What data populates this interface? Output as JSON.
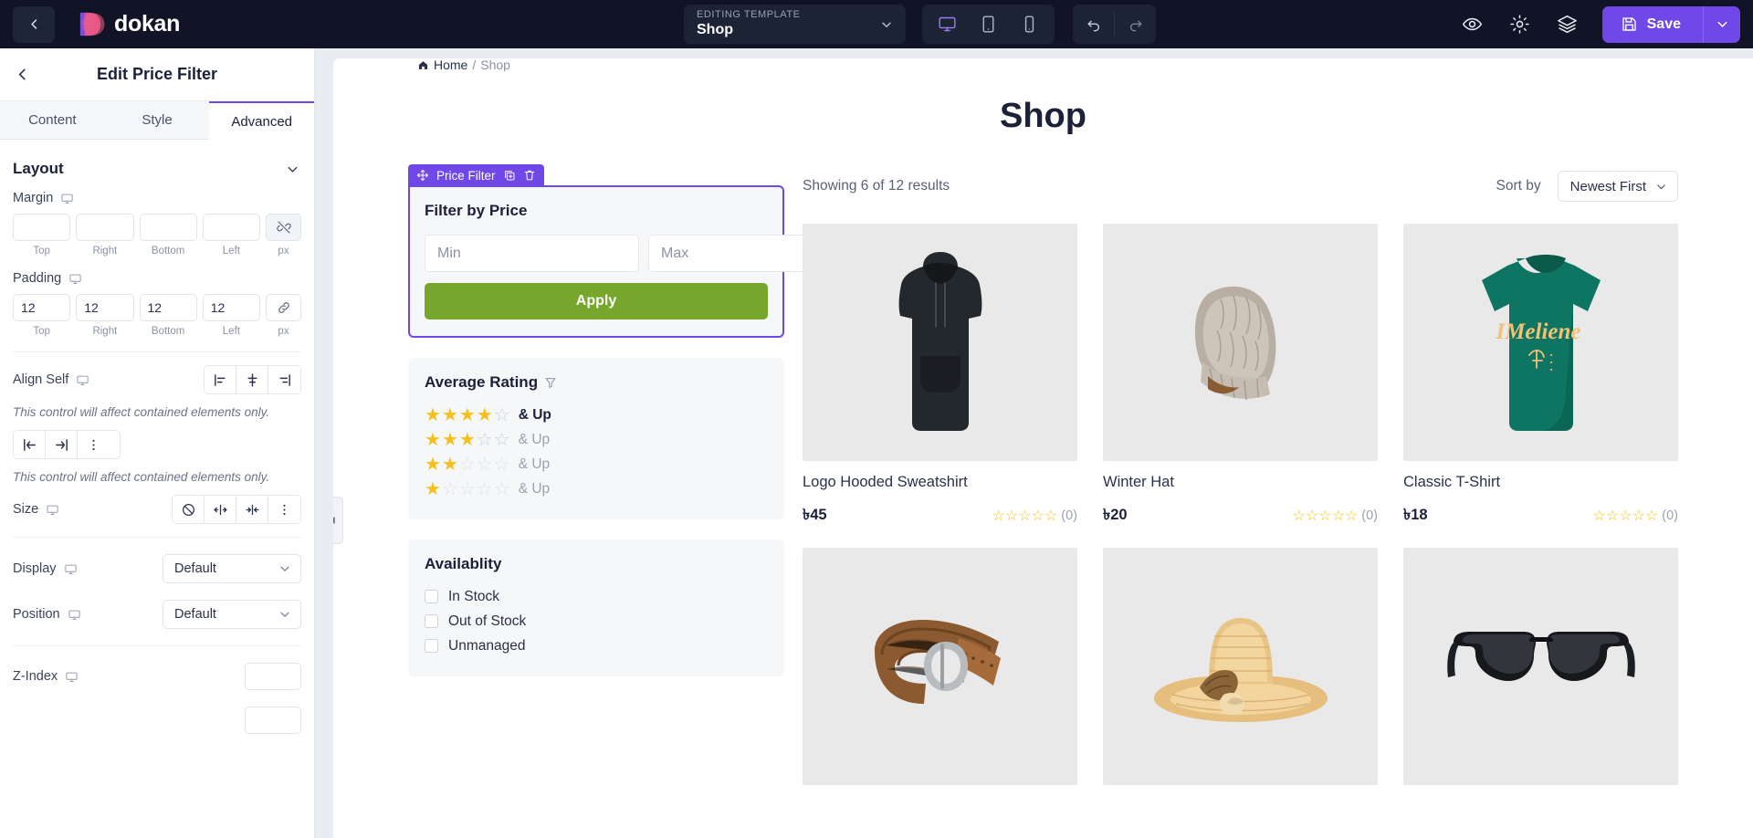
{
  "topbar": {
    "back_icon": "chevron-left-icon",
    "brand": "dokan",
    "template_eyebrow": "EDITING TEMPLATE",
    "template_name": "Shop",
    "devices": [
      {
        "name": "desktop-view-button",
        "icon": "desktop-icon",
        "active": true
      },
      {
        "name": "tablet-view-button",
        "icon": "tablet-icon",
        "active": false
      },
      {
        "name": "mobile-view-button",
        "icon": "mobile-icon",
        "active": false
      }
    ],
    "history": [
      {
        "name": "undo-button",
        "icon": "undo-icon"
      },
      {
        "name": "redo-button",
        "icon": "redo-icon"
      }
    ],
    "right_icons": [
      {
        "name": "preview-button",
        "icon": "eye-icon"
      },
      {
        "name": "settings-button",
        "icon": "gear-icon"
      },
      {
        "name": "layers-button",
        "icon": "layers-icon"
      }
    ],
    "save_label": "Save",
    "save_icon": "floppy-disk-icon",
    "save_caret_icon": "chevron-down-icon",
    "accent": "#7048e8",
    "background": "#101426"
  },
  "sidebar": {
    "back_icon": "chevron-left-icon",
    "title": "Edit Price Filter",
    "tabs": [
      {
        "label": "Content",
        "active": false
      },
      {
        "label": "Style",
        "active": false
      },
      {
        "label": "Advanced",
        "active": true
      }
    ],
    "layout_section": {
      "title": "Layout",
      "collapse_icon": "chevron-down-icon",
      "margin": {
        "label": "Margin",
        "device_icon": "desktop-icon",
        "values": [
          "",
          "",
          "",
          ""
        ],
        "captions": [
          "Top",
          "Right",
          "Bottom",
          "Left"
        ],
        "unit": "px",
        "link_icon": "unlink-icon",
        "linked": false
      },
      "padding": {
        "label": "Padding",
        "device_icon": "desktop-icon",
        "values": [
          "12",
          "12",
          "12",
          "12"
        ],
        "captions": [
          "Top",
          "Right",
          "Bottom",
          "Left"
        ],
        "unit": "px",
        "link_icon": "link-icon",
        "linked": true
      },
      "align_self": {
        "label": "Align Self",
        "device_icon": "desktop-icon",
        "options": [
          "align-start-icon",
          "align-center-icon",
          "align-end-icon"
        ],
        "hint": "This control will affect contained elements only."
      },
      "justify_self": {
        "options": [
          "justify-start-icon",
          "justify-end-icon",
          "more-vertical-icon"
        ],
        "hint": "This control will affect contained elements only."
      },
      "size": {
        "label": "Size",
        "device_icon": "desktop-icon",
        "options": [
          "none-icon",
          "grow-icon",
          "shrink-icon",
          "more-vertical-icon"
        ]
      },
      "display": {
        "label": "Display",
        "device_icon": "desktop-icon",
        "value": "Default",
        "caret_icon": "chevron-down-icon"
      },
      "position": {
        "label": "Position",
        "device_icon": "desktop-icon",
        "value": "Default",
        "caret_icon": "chevron-down-icon"
      },
      "z_index": {
        "label": "Z-Index",
        "device_icon": "desktop-icon",
        "value": ""
      }
    }
  },
  "canvas": {
    "collapse_icon": "chevron-left-icon",
    "breadcrumb": {
      "home": "Home",
      "sep": "/",
      "current": "Shop",
      "home_icon": "home-icon"
    },
    "page_title": "Shop",
    "widget_badge": {
      "label": "Price Filter",
      "drag_icon": "move-icon",
      "duplicate_icon": "duplicate-icon",
      "delete_icon": "trash-icon"
    },
    "price_filter": {
      "title": "Filter by Price",
      "min_placeholder": "Min",
      "min_value": "",
      "max_placeholder": "Max",
      "max_value": "",
      "apply_label": "Apply",
      "apply_color": "#76a62c"
    },
    "average_rating": {
      "title": "Average Rating",
      "filter_icon": "funnel-icon",
      "suffix": "& Up",
      "options": [
        {
          "filled": 4,
          "total": 5,
          "label": "& Up",
          "selected": true
        },
        {
          "filled": 3,
          "total": 5,
          "label": "& Up",
          "selected": false
        },
        {
          "filled": 2,
          "total": 5,
          "label": "& Up",
          "selected": false
        },
        {
          "filled": 1,
          "total": 5,
          "label": "& Up",
          "selected": false
        }
      ]
    },
    "availability": {
      "title": "Availablity",
      "options": [
        {
          "label": "In Stock",
          "checked": false
        },
        {
          "label": "Out of Stock",
          "checked": false
        },
        {
          "label": "Unmanaged",
          "checked": false
        }
      ]
    },
    "results_text": "Showing 6 of 12 results",
    "sort_label": "Sort by",
    "sort_value": "Newest First",
    "sort_caret_icon": "chevron-down-icon",
    "products": [
      {
        "name": "Logo Hooded Sweatshirt",
        "price": "৳45",
        "stars": 0,
        "reviews": "(0)",
        "image": "black-hoodie"
      },
      {
        "name": "Winter Hat",
        "price": "৳20",
        "stars": 0,
        "reviews": "(0)",
        "image": "knit-beanie"
      },
      {
        "name": "Classic T-Shirt",
        "price": "৳18",
        "stars": 0,
        "reviews": "(0)",
        "image": "teal-tshirt"
      },
      {
        "name": "",
        "price": "",
        "stars": 0,
        "reviews": "",
        "image": "brown-belt"
      },
      {
        "name": "",
        "price": "",
        "stars": 0,
        "reviews": "",
        "image": "straw-hat"
      },
      {
        "name": "",
        "price": "",
        "stars": 0,
        "reviews": "",
        "image": "sunglasses"
      }
    ]
  }
}
